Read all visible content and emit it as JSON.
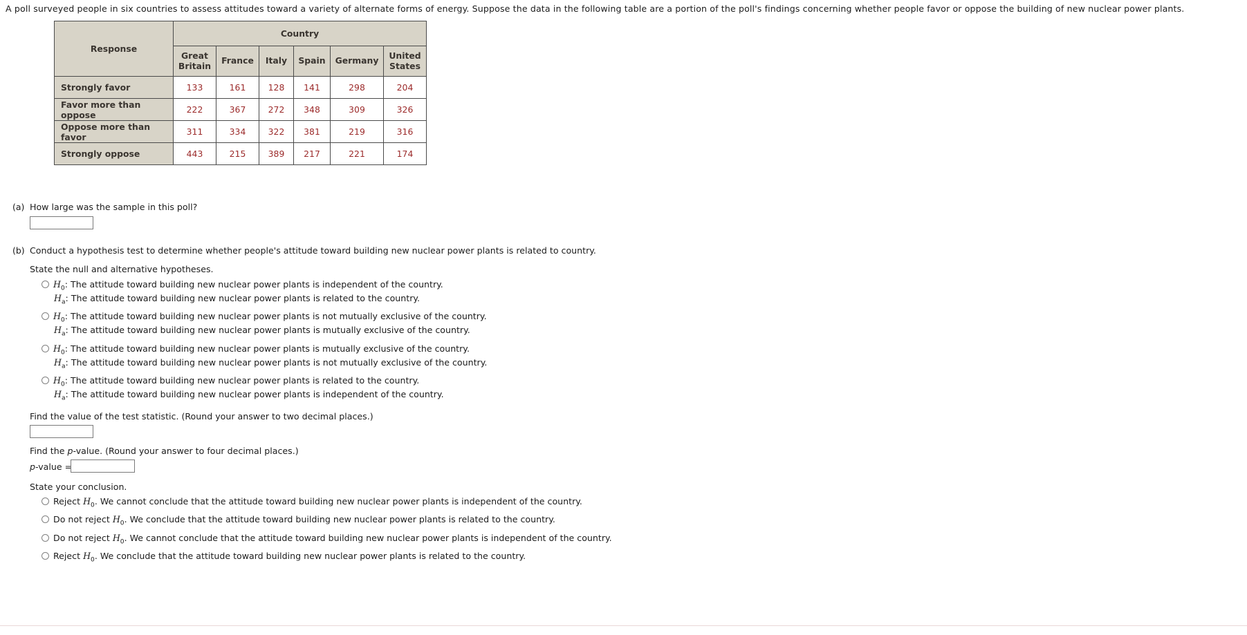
{
  "intro": "A poll surveyed people in six countries to assess attitudes toward a variety of alternate forms of energy. Suppose the data in the following table are a portion of the poll's findings concerning whether people favor or oppose the building of new nuclear power plants.",
  "table": {
    "response_header": "Response",
    "group_header": "Country",
    "columns": [
      "Great Britain",
      "France",
      "Italy",
      "Spain",
      "Germany",
      "United States"
    ],
    "rows": [
      {
        "label": "Strongly favor",
        "values": [
          133,
          161,
          128,
          141,
          298,
          204
        ]
      },
      {
        "label": "Favor more than oppose",
        "values": [
          222,
          367,
          272,
          348,
          309,
          326
        ]
      },
      {
        "label": "Oppose more than favor",
        "values": [
          311,
          334,
          322,
          381,
          219,
          316
        ]
      },
      {
        "label": "Strongly oppose",
        "values": [
          443,
          215,
          389,
          217,
          221,
          174
        ]
      }
    ]
  },
  "part_a": {
    "marker": "(a)",
    "question": "How large was the sample in this poll?",
    "input_value": "",
    "input_placeholder": ""
  },
  "part_b": {
    "marker": "(b)",
    "question": "Conduct a hypothesis test to determine whether people's attitude toward building new nuclear power plants is related to country.",
    "hypotheses_prompt": "State the null and alternative hypotheses.",
    "hypothesis_options": [
      {
        "null": "The attitude toward building new nuclear power plants is independent of the country.",
        "alt": "The attitude toward building new nuclear power plants is related to the country."
      },
      {
        "null": "The attitude toward building new nuclear power plants is not mutually exclusive of the country.",
        "alt": "The attitude toward building new nuclear power plants is mutually exclusive of the country."
      },
      {
        "null": "The attitude toward building new nuclear power plants is mutually exclusive of the country.",
        "alt": "The attitude toward building new nuclear power plants is not mutually exclusive of the country."
      },
      {
        "null": "The attitude toward building new nuclear power plants is related to the country.",
        "alt": "The attitude toward building new nuclear power plants is independent of the country."
      }
    ],
    "test_statistic_prompt": "Find the value of the test statistic. (Round your answer to two decimal places.)",
    "test_statistic_value": "",
    "pvalue_prompt_pre": "Find the ",
    "pvalue_prompt_italic": "p",
    "pvalue_prompt_post": "-value. (Round your answer to four decimal places.)",
    "pvalue_label_italic": "p",
    "pvalue_label_post": "-value =",
    "pvalue_value": "",
    "conclusion_prompt": "State your conclusion.",
    "conclusion_options": [
      "Reject H0. We cannot conclude that the attitude toward building new nuclear power plants is independent of the country.",
      "Do not reject H0. We conclude that the attitude toward building new nuclear power plants is related to the country.",
      "Do not reject H0. We cannot conclude that the attitude toward building new nuclear power plants is independent of the country.",
      "Reject H0. We conclude that the attitude toward building new nuclear power plants is related to the country."
    ],
    "conclusion_parts": [
      {
        "lead": "Reject",
        "rest": ". We cannot conclude that the attitude toward building new nuclear power plants is independent of the country."
      },
      {
        "lead": "Do not reject",
        "rest": ". We conclude that the attitude toward building new nuclear power plants is related to the country."
      },
      {
        "lead": "Do not reject",
        "rest": ". We cannot conclude that the attitude toward building new nuclear power plants is independent of the country."
      },
      {
        "lead": "Reject",
        "rest": ". We conclude that the attitude toward building new nuclear power plants is related to the country."
      }
    ]
  },
  "symbols": {
    "h_null": "H",
    "h_null_sub": "0",
    "h_alt": "H",
    "h_alt_sub": "a",
    "colon": ":"
  },
  "colors": {
    "table_header_bg": "#d8d4c8",
    "table_number": "#9c2b2b",
    "border": "#4a4a4a",
    "text": "#1c1c1c"
  }
}
